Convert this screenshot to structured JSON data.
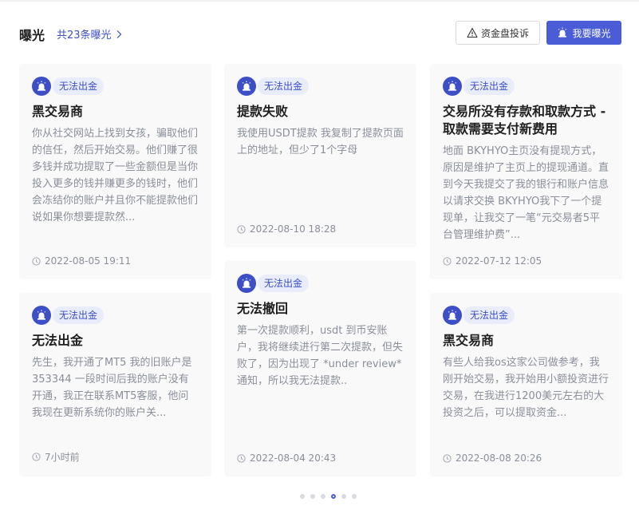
{
  "header": {
    "title": "曝光",
    "count_label": "共23条曝光",
    "complain_button": "资金盘投诉",
    "expose_button": "我要曝光"
  },
  "cards": [
    {
      "tag": "无法出金",
      "title": "黑交易商",
      "desc": "你从社交网站上找到女孩，骗取他们的信任，然后开始交易。他们赚了很多钱并成功提取了一些金额但是当你投入更多的钱并赚更多的钱时，他们会冻结你的账户并且你不能提款他们说如果你想要提款然...",
      "time": "2022-08-05 19:11"
    },
    {
      "tag": "无法出金",
      "title": "提款失败",
      "desc": "我使用USDT提款 我复制了提款页面上的地址，但少了1个字母",
      "time": "2022-08-10 18:28"
    },
    {
      "tag": "无法出金",
      "title": "交易所没有存款和取款方式 - 取款需要支付新费用",
      "desc": "地面 BKYHYO主页没有提现方式，原因是维护了主页上的提现通道。直到今天我提交了我的银行和账户信息以请求交换 BKYHYO我下了一个提现单，让我交了一笔“元交易者5平台管理维护费”...",
      "time": "2022-07-12 12:05"
    },
    {
      "tag": "无法出金",
      "title": "无法出金",
      "desc": "先生，我开通了MT5 我的旧账户是353344 一段时间后我的账户没有开通，我正在联系MT5客服，他问我现在更新系统你的账户关...",
      "time": "7小时前"
    },
    {
      "tag": "无法出金",
      "title": "无法撤回",
      "desc": "第一次提款顺利，usdt 到币安账户，我将继续进行第二次提款，但失败了，因为出现了 *under review* 通知，所以我无法提款..",
      "time": "2022-08-04 20:43"
    },
    {
      "tag": "无法出金",
      "title": "黑交易商",
      "desc": "有些人给我os这家公司做参考，我刚开始交易，我开始用小额投资进行交易，在我进行1200美元左右的大投资之后，可以提取资金...",
      "time": "2022-08-08 20:26"
    }
  ],
  "pagination": {
    "total": 6,
    "active": 4
  }
}
